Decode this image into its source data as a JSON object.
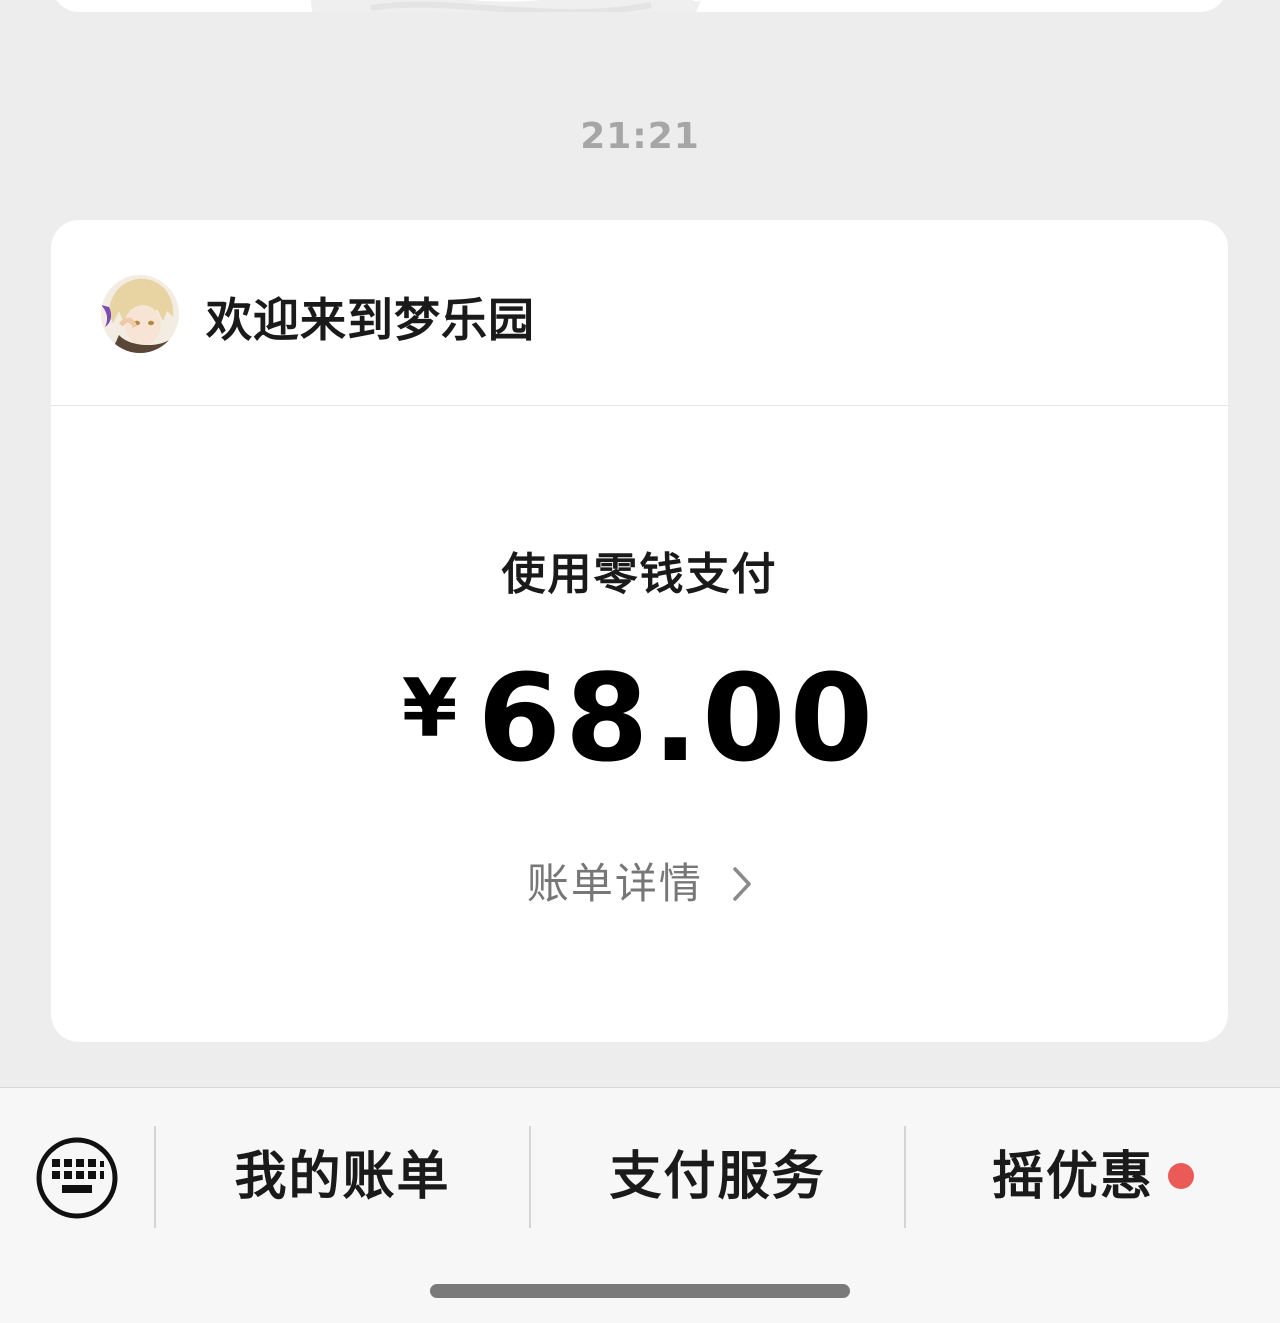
{
  "chat": {
    "timestamp": "21:21"
  },
  "payment_card": {
    "merchant": {
      "name": "欢迎来到梦乐园",
      "avatar_icon": "anime-avatar"
    },
    "method_label": "使用零钱支付",
    "currency_symbol": "¥",
    "amount": "68.00",
    "detail_link": "账单详情"
  },
  "bottom_menu": {
    "keyboard_icon": "keyboard-icon",
    "items": [
      {
        "label": "我的账单"
      },
      {
        "label": "支付服务"
      },
      {
        "label": "摇优惠",
        "has_badge": true,
        "badge_color": "#ea5a57"
      }
    ]
  },
  "colors": {
    "background": "#ededed",
    "card": "#ffffff",
    "timestamp": "#a6a6a6",
    "badge": "#ea5a57"
  }
}
